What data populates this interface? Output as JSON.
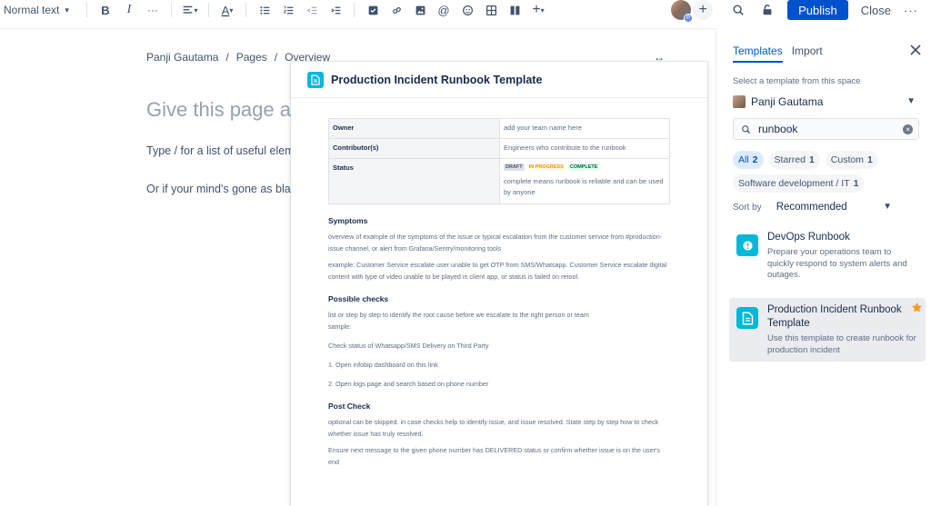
{
  "toolbar": {
    "text_style": "Normal text",
    "bold": "B",
    "italic": "I",
    "more_format": "···",
    "publish_label": "Publish",
    "close_label": "Close",
    "more_actions": "···",
    "insert_plus": "+"
  },
  "editor": {
    "breadcrumb": [
      "Panji Gautama",
      "Pages",
      "Overview"
    ],
    "breadcrumb_sep": "/",
    "width_toggle": "↔",
    "title_placeholder": "Give this page a title",
    "hint_prefix": "Type / for a list of ",
    "hint_underlined": "useful",
    "hint_suffix": " elements",
    "hint_2": "Or if your mind's gone as blank as this page"
  },
  "preview": {
    "title": "Production Incident Runbook Template",
    "table": {
      "owner_label": "Owner",
      "owner_value": "add your team name here",
      "contributors_label": "Contributor(s)",
      "contributors_value": "Engineers who contribute to the runbook",
      "status_label": "Status",
      "status_lozenges": [
        "DRAFT",
        "IN PROGRESS",
        "COMPLETE"
      ],
      "status_desc": "complete means runbook is reliable and can be used by anyone"
    },
    "sections": {
      "symptoms_title": "Symptoms",
      "symptoms_p1": "overview of example of the symptoms of the issue or typical escalation from the customer service from #production-issue channel, or alert from Grafana/Sentry/monitoring tools",
      "symptoms_p2": "example: Customer Service escalate user unable to get OTP from SMS/Whatsapp. Customer Service escalate digital content with type of video unable to be played in client app, or status is failed on retool.",
      "checks_title": "Possible checks",
      "checks_p1": "list or step by step to identify the root cause before we escalate to the right person or team",
      "checks_p1b": "sample:",
      "checks_p2": "Check status of Whatsapp/SMS Delivery on Third Party",
      "checks_p3": "1. Open infobip dashboard on this link",
      "checks_p4": "2. Open logs page and search based on phone number",
      "post_title": "Post Check",
      "post_p1": "optional can be skipped. in case checks help to identify issue, and issue resolved. State step by step how to check whether issue has truly resolved.",
      "post_p2": "Ensure next message to the given phone number has DELIVERED status or confirm whether issue is on the user's end"
    }
  },
  "panel": {
    "tabs": [
      "Templates",
      "Import"
    ],
    "space_label": "Select a template from this space",
    "space_value": "Panji Gautama",
    "search_value": "runbook",
    "chips": [
      {
        "label": "All",
        "count": "2"
      },
      {
        "label": "Starred",
        "count": "1"
      },
      {
        "label": "Custom",
        "count": "1"
      },
      {
        "label": "Software development / IT",
        "count": "1"
      }
    ],
    "sort_label": "Sort by",
    "sort_value": "Recommended",
    "templates": [
      {
        "name": "DevOps Runbook",
        "desc": "Prepare your operations team to quickly respond to system alerts and outages."
      },
      {
        "name": "Production Incident Runbook Template",
        "desc": "Use this template to create runbook for production incident"
      }
    ]
  },
  "colors": {
    "accent": "#0052cc",
    "template_icon": "#00b8d9",
    "star": "#ff991f"
  }
}
